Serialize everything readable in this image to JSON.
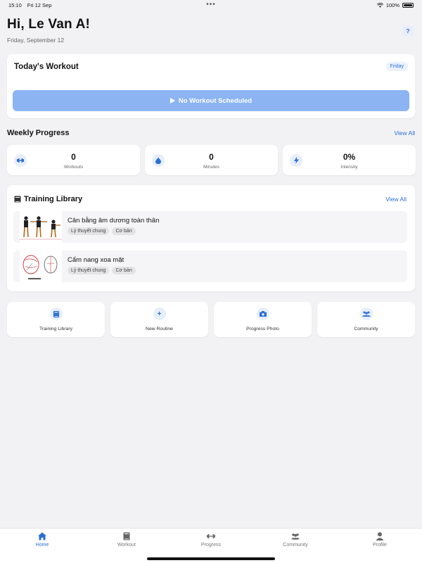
{
  "status_bar": {
    "time": "15:10",
    "date": "Fri 12 Sep",
    "battery": "100%"
  },
  "header": {
    "greeting": "Hi, Le Van A!",
    "date": "Friday, September 12",
    "help_icon": "question-icon"
  },
  "today": {
    "title": "Today's Workout",
    "day_badge": "Friday",
    "button_label": "No Workout Scheduled",
    "button_color": "#8cb4f2"
  },
  "weekly": {
    "title": "Weekly Progress",
    "view_all": "View All",
    "stats": [
      {
        "icon": "dumbbell-icon",
        "value": "0",
        "label": "Workouts"
      },
      {
        "icon": "flame-icon",
        "value": "0",
        "label": "Minutes"
      },
      {
        "icon": "lightning-icon",
        "value": "0%",
        "label": "Intensity"
      }
    ]
  },
  "library": {
    "title": "Training Library",
    "view_all": "View All",
    "items": [
      {
        "name": "Cân bằng âm dương toàn thân",
        "tags": [
          "Lý thuyết chung",
          "Cơ bản"
        ]
      },
      {
        "name": "Cẩm nang xoa mặt",
        "tags": [
          "Lý thuyết chung",
          "Cơ bản"
        ]
      }
    ]
  },
  "quick_actions": [
    {
      "icon": "book-icon",
      "label": "Training Library"
    },
    {
      "icon": "plus-icon",
      "label": "New Routine"
    },
    {
      "icon": "camera-icon",
      "label": "Progress Photo"
    },
    {
      "icon": "people-icon",
      "label": "Community"
    }
  ],
  "tabs": [
    {
      "icon": "home-icon",
      "label": "Home",
      "active": true
    },
    {
      "icon": "book-icon",
      "label": "Workout",
      "active": false
    },
    {
      "icon": "dumbbell-icon",
      "label": "Progress",
      "active": false
    },
    {
      "icon": "people-icon",
      "label": "Community",
      "active": false
    },
    {
      "icon": "person-icon",
      "label": "Profile",
      "active": false
    }
  ],
  "colors": {
    "accent": "#2a6fd6",
    "background": "#f2f2f4"
  }
}
